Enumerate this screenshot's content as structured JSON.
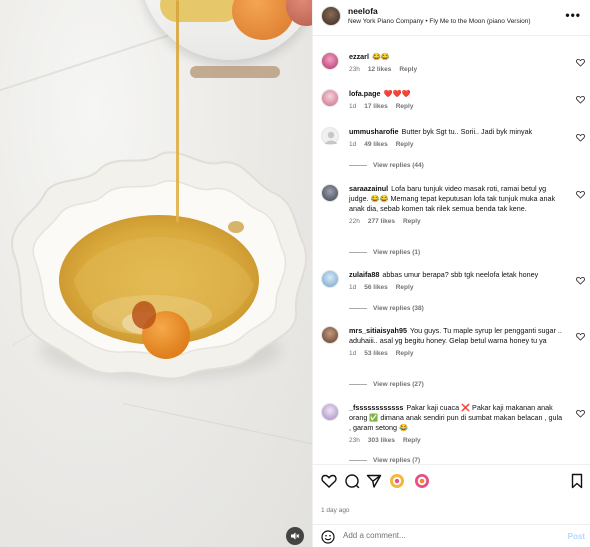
{
  "post": {
    "username": "neelofa",
    "music": "New York Piano Company • Fly Me to the Moon (piano Version)",
    "more_icon": "more-icon",
    "date": "1 day ago"
  },
  "comments": [
    {
      "username": "ezzarl",
      "text": "😂😂",
      "time": "23h",
      "likes": "12 likes",
      "reply": "Reply",
      "avatar_color": "#d64f8a"
    },
    {
      "username": "lofa.page",
      "text": "❤️❤️❤️",
      "time": "1d",
      "likes": "17 likes",
      "reply": "Reply",
      "avatar_color": "#e7a6b7"
    },
    {
      "username": "ummusharofie",
      "text": "Butter byk Sgt tu.. Sorii.. Jadi byk minyak",
      "time": "1d",
      "likes": "49 likes",
      "reply": "Reply",
      "avatar_color": "#e0e0e0",
      "view_replies": "View replies (44)"
    },
    {
      "username": "saraazainul",
      "text": "Lofa baru tunjuk video masak roti, ramai betul yg judge. 😂😂 Memang tepat keputusan lofa tak tunjuk muka anak anak dia, sebab komen tak rilek semua benda tak kene.",
      "time": "22h",
      "likes": "277 likes",
      "reply": "Reply",
      "avatar_color": "#6b6f7a",
      "view_replies": "View replies (1)"
    },
    {
      "username": "zulaifa88",
      "text": "abbas umur berapa? sbb tgk neelofa letak honey",
      "time": "1d",
      "likes": "56 likes",
      "reply": "Reply",
      "avatar_color": "#9cc3e6",
      "view_replies": "View replies (38)"
    },
    {
      "username": "mrs_sitiaisyah95",
      "text": "You guys. Tu maple syrup ler pengganti sugar .. aduhaiii.. asal yg begitu honey. Gelap betul warna honey tu ya",
      "time": "1d",
      "likes": "53 likes",
      "reply": "Reply",
      "avatar_color": "#7a5b46",
      "view_replies": "View replies (27)"
    },
    {
      "username": "_fssssssssssss",
      "text": "Pakar kaji cuaca ❌ Pakar kaji makanan anak orang ✅ dimana anak sendiri pun di sumbat makan belacan , gula , garam setong 😂",
      "time": "23h",
      "likes": "303 likes",
      "reply": "Reply",
      "avatar_color": "#c9b6d8",
      "view_replies": "View replies (7)"
    }
  ],
  "actions": {
    "like_icon": "heart-icon",
    "comment_icon": "comment-icon",
    "share_icon": "send-icon",
    "save_icon": "bookmark-icon"
  },
  "add_comment": {
    "placeholder": "Add a comment...",
    "post_label": "Post"
  }
}
